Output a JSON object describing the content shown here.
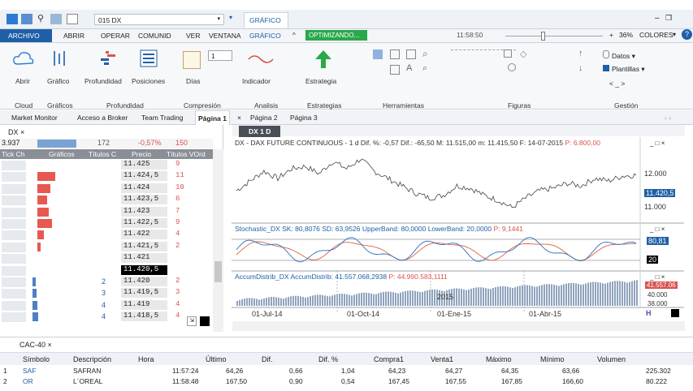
{
  "titlebar": {
    "symbol": "015 DX",
    "active_tab": "GRÁFICO",
    "time": "11:58:50",
    "zoom": "36%",
    "colors_label": "COLORES"
  },
  "menu": {
    "items": [
      "ARCHIVO",
      "ABRIR",
      "OPERAR",
      "COMUNID",
      "VER",
      "VENTANA",
      "GRÁFICO"
    ],
    "status": "OPTIMIZANDO..."
  },
  "ribbon": {
    "buttons": [
      "Abrir",
      "Gráfico",
      "Profundidad",
      "Posiciones",
      "Días",
      "Indicador",
      "Estrategia"
    ],
    "small": {
      "days_value": "1",
      "datos": "Datos",
      "plantillas": "Plantillas",
      "nav": "< _ >"
    },
    "groups": [
      "Cloud",
      "Gráficos",
      "Profundidad",
      "Compresión",
      "Analisis",
      "Estrategias",
      "Herramientas",
      "Figuras",
      "Gestión"
    ]
  },
  "tabs": {
    "items": [
      "Market Monitor",
      "Acceso a Broker",
      "Team Trading",
      "Página 1",
      "Página 2",
      "Página 3"
    ],
    "close_x": "×"
  },
  "ladder": {
    "tab": "DX",
    "summary": [
      "3.937",
      "172",
      "-0,57%",
      "150"
    ],
    "headers": [
      "Tick Ch",
      "Gráficos",
      "Títulos C",
      "Precio",
      "Títulos VOrd"
    ],
    "rows": [
      {
        "price": "11.425",
        "qty": "9"
      },
      {
        "price": "11.424,5",
        "qty": "11"
      },
      {
        "price": "11.424",
        "qty": "10"
      },
      {
        "price": "11.423,5",
        "qty": "6"
      },
      {
        "price": "11.423",
        "qty": "7"
      },
      {
        "price": "11.422,5",
        "qty": "9"
      },
      {
        "price": "11.422",
        "qty": "4"
      },
      {
        "price": "11.421,5",
        "qty": "2"
      },
      {
        "price": "11.421",
        "qty": ""
      },
      {
        "price": "11.420,5",
        "qty": ""
      },
      {
        "price": "11.420",
        "qty": "2"
      },
      {
        "price": "11.419,5",
        "qty": "3"
      },
      {
        "price": "11.419",
        "qty": "4"
      },
      {
        "price": "11.418,5",
        "qty": "4"
      }
    ],
    "buy_qty": [
      "",
      "",
      "",
      "",
      "",
      "",
      "",
      "",
      "",
      "",
      "2",
      "3",
      "4",
      "4"
    ]
  },
  "chart": {
    "tab": "DX 1 D",
    "main_title": "DX - DAX FUTURE CONTINUOUS - 1 d Dif. %: -0,57 Dif.: -65,50 M: 11.515,00 m: 11.415,50 F: 14-07-2015",
    "main_title_p": "P: 6.800,00",
    "stoch_title": "Stochastic_DX SK: 80,8076 SD: 63,9526 UpperBand: 80,0000 LowerBand: 20,0000",
    "stoch_title_p": "P: 9,1441",
    "accum_title": "AccumDistrib_DX AccumDistrib: 41.557.068,2938",
    "accum_title_p": "P: 44.990.583,1111",
    "y_labels": [
      "12.000",
      "11.420,5",
      "11.000"
    ],
    "stoch_labels": [
      "80,81",
      "20"
    ],
    "accum_labels": [
      "41.557.06",
      "40.000",
      "38.000"
    ],
    "year_label": "2015",
    "x_labels": [
      "01-Jul-14",
      "01-Oct-14",
      "01-Ene-15",
      "01-Abr-15"
    ]
  },
  "chart_data": {
    "type": "line",
    "series": [
      {
        "values": [
          11.1,
          11.3,
          11.5,
          11.35,
          11.55,
          11.6,
          11.45,
          11.7,
          11.55,
          11.75,
          11.5,
          11.35,
          11.2,
          11.05,
          10.95,
          11.0,
          11.2,
          11.15,
          11.0,
          10.9,
          10.75,
          10.95,
          11.1,
          11.15,
          11.25,
          11.2,
          11.35,
          11.3,
          11.4,
          11.42
        ]
      }
    ]
  },
  "bottom": {
    "tab": "CAC-40",
    "headers": [
      "Símbolo",
      "Descripción",
      "Hora",
      "Último",
      "Dif.",
      "Dif. %",
      "Compra1",
      "Venta1",
      "Máximo",
      "Mínimo",
      "Volumen"
    ],
    "rows": [
      [
        "1",
        "SAF",
        "SAFRAN",
        "11:57:24",
        "64,26",
        "0,66",
        "1,04",
        "64,23",
        "64,27",
        "64,35",
        "63,66",
        "225.302"
      ],
      [
        "2",
        "OR",
        "L´OREAL",
        "11:58:48",
        "167,50",
        "0,90",
        "0,54",
        "167,45",
        "167,55",
        "167,85",
        "166,60",
        "80.222"
      ]
    ]
  },
  "colors": {
    "accent": "#1f5fa8",
    "highlight": "#d9534f",
    "positive": "#228b22"
  }
}
